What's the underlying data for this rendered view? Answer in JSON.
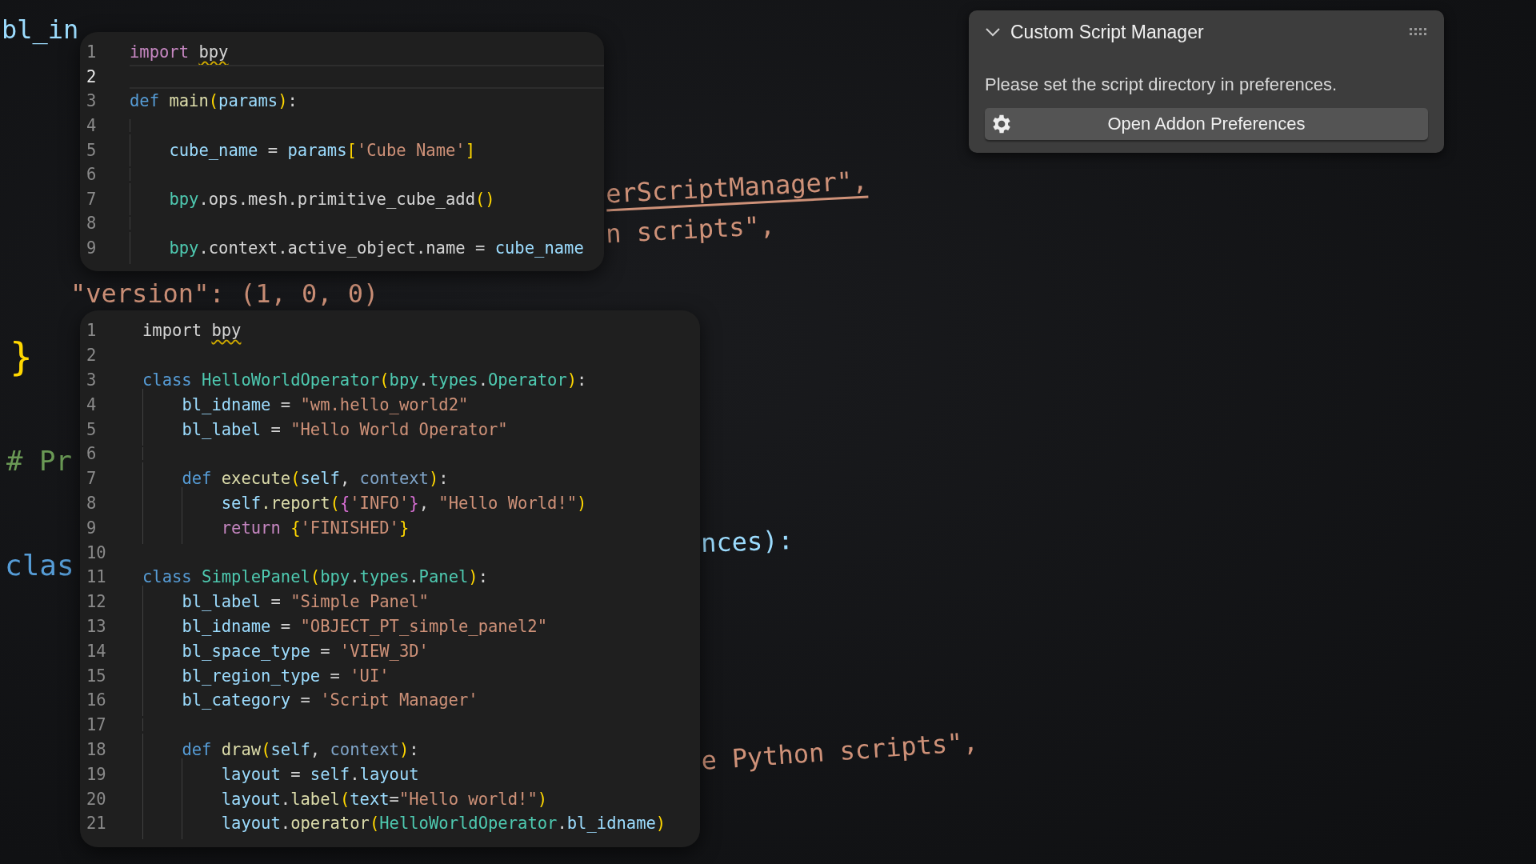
{
  "background_fragments": [
    {
      "text": "bl_in",
      "kind": "var"
    },
    {
      "text": "\"version\": (1, 0, 0)",
      "kind": "str"
    },
    {
      "text": "}",
      "kind": "br"
    },
    {
      "text": "# Pr",
      "kind": "comment"
    },
    {
      "text": "clas",
      "kind": "kw"
    },
    {
      "text": "erScriptManager\",",
      "kind": "link"
    },
    {
      "text": "n scripts\",",
      "kind": "str"
    },
    {
      "text": "nces):",
      "kind": "var"
    },
    {
      "text": "e Python scripts\",",
      "kind": "str"
    }
  ],
  "editors": [
    {
      "lines": [
        {
          "n": "1",
          "current": false,
          "tokens": [
            {
              "text": "import ",
              "kind": "imp"
            },
            {
              "text": "bpy",
              "kind": "warn"
            }
          ]
        },
        {
          "n": "2",
          "current": true
        },
        {
          "n": "3",
          "current": false,
          "tokens": [
            {
              "text": "def ",
              "kind": "kw"
            },
            {
              "text": "main",
              "kind": "fn"
            },
            {
              "text": "(",
              "kind": "br"
            },
            {
              "text": "params",
              "kind": "var"
            },
            {
              "text": ")",
              "kind": "br"
            },
            {
              "text": ":",
              "kind": "pl"
            }
          ]
        },
        {
          "n": "4",
          "current": false
        },
        {
          "n": "5",
          "current": false,
          "tokens": [
            {
              "text": "    cube_name",
              "kind": "var"
            },
            {
              "text": " = ",
              "kind": "pl"
            },
            {
              "text": "params",
              "kind": "var"
            },
            {
              "text": "[",
              "kind": "br"
            },
            {
              "text": "'Cube Name'",
              "kind": "str"
            },
            {
              "text": "]",
              "kind": "br"
            }
          ]
        },
        {
          "n": "6",
          "current": false
        },
        {
          "n": "7",
          "current": false,
          "tokens": [
            {
              "text": "    bpy",
              "kind": "cls"
            },
            {
              "text": ".ops.mesh.primitive_cube_add",
              "kind": "pl"
            },
            {
              "text": "()",
              "kind": "br"
            }
          ]
        },
        {
          "n": "8",
          "current": false
        },
        {
          "n": "9",
          "current": false,
          "tokens": [
            {
              "text": "    bpy",
              "kind": "cls"
            },
            {
              "text": ".context.active_object.name = ",
              "kind": "pl"
            },
            {
              "text": "cube_name",
              "kind": "var"
            }
          ]
        }
      ]
    },
    {
      "lines": [
        {
          "n": "1",
          "tokens": [
            {
              "text": "import ",
              "kind": "plain"
            },
            {
              "text": "bpy",
              "kind": "warn"
            }
          ]
        },
        {
          "n": "2"
        },
        {
          "n": "3",
          "tokens": [
            {
              "text": "class ",
              "kind": "kw"
            },
            {
              "text": "HelloWorldOperator",
              "kind": "cls"
            },
            {
              "text": "(",
              "kind": "br"
            },
            {
              "text": "bpy",
              "kind": "cls"
            },
            {
              "text": ".",
              "kind": "pl"
            },
            {
              "text": "types",
              "kind": "cls"
            },
            {
              "text": ".",
              "kind": "pl"
            },
            {
              "text": "Operator",
              "kind": "cls"
            },
            {
              "text": ")",
              "kind": "br"
            },
            {
              "text": ":",
              "kind": "pl"
            }
          ]
        },
        {
          "n": "4",
          "tokens": [
            {
              "text": "    bl_idname",
              "kind": "var"
            },
            {
              "text": " = ",
              "kind": "pl"
            },
            {
              "text": "\"wm.hello_world2\"",
              "kind": "str"
            }
          ]
        },
        {
          "n": "5",
          "tokens": [
            {
              "text": "    bl_label",
              "kind": "var"
            },
            {
              "text": " = ",
              "kind": "pl"
            },
            {
              "text": "\"Hello World Operator\"",
              "kind": "str"
            }
          ]
        },
        {
          "n": "6"
        },
        {
          "n": "7",
          "tokens": [
            {
              "text": "    def ",
              "kind": "kw"
            },
            {
              "text": "execute",
              "kind": "fn"
            },
            {
              "text": "(",
              "kind": "br"
            },
            {
              "text": "self",
              "kind": "var"
            },
            {
              "text": ", ",
              "kind": "pl"
            },
            {
              "text": "context",
              "kind": "dim"
            },
            {
              "text": ")",
              "kind": "br"
            },
            {
              "text": ":",
              "kind": "pl"
            }
          ]
        },
        {
          "n": "8",
          "tokens": [
            {
              "text": "        self",
              "kind": "var"
            },
            {
              "text": ".report",
              "kind": "fn"
            },
            {
              "text": "(",
              "kind": "br"
            },
            {
              "text": "{",
              "kind": "br2"
            },
            {
              "text": "'INFO'",
              "kind": "str"
            },
            {
              "text": "}",
              "kind": "br2"
            },
            {
              "text": ", ",
              "kind": "pl"
            },
            {
              "text": "\"Hello World!\"",
              "kind": "str"
            },
            {
              "text": ")",
              "kind": "br"
            }
          ]
        },
        {
          "n": "9",
          "tokens": [
            {
              "text": "        return ",
              "kind": "imp"
            },
            {
              "text": "{",
              "kind": "br"
            },
            {
              "text": "'FINISHED'",
              "kind": "str"
            },
            {
              "text": "}",
              "kind": "br"
            }
          ]
        },
        {
          "n": "10"
        },
        {
          "n": "11",
          "tokens": [
            {
              "text": "class ",
              "kind": "kw"
            },
            {
              "text": "SimplePanel",
              "kind": "cls"
            },
            {
              "text": "(",
              "kind": "br"
            },
            {
              "text": "bpy",
              "kind": "cls"
            },
            {
              "text": ".",
              "kind": "pl"
            },
            {
              "text": "types",
              "kind": "cls"
            },
            {
              "text": ".",
              "kind": "pl"
            },
            {
              "text": "Panel",
              "kind": "cls"
            },
            {
              "text": ")",
              "kind": "br"
            },
            {
              "text": ":",
              "kind": "pl"
            }
          ]
        },
        {
          "n": "12",
          "tokens": [
            {
              "text": "    bl_label",
              "kind": "var"
            },
            {
              "text": " = ",
              "kind": "pl"
            },
            {
              "text": "\"Simple Panel\"",
              "kind": "str"
            }
          ]
        },
        {
          "n": "13",
          "tokens": [
            {
              "text": "    bl_idname",
              "kind": "var"
            },
            {
              "text": " = ",
              "kind": "pl"
            },
            {
              "text": "\"OBJECT_PT_simple_panel2\"",
              "kind": "str"
            }
          ]
        },
        {
          "n": "14",
          "tokens": [
            {
              "text": "    bl_space_type",
              "kind": "var"
            },
            {
              "text": " = ",
              "kind": "pl"
            },
            {
              "text": "'VIEW_3D'",
              "kind": "str"
            }
          ]
        },
        {
          "n": "15",
          "tokens": [
            {
              "text": "    bl_region_type",
              "kind": "var"
            },
            {
              "text": " = ",
              "kind": "pl"
            },
            {
              "text": "'UI'",
              "kind": "str"
            }
          ]
        },
        {
          "n": "16",
          "tokens": [
            {
              "text": "    bl_category",
              "kind": "var"
            },
            {
              "text": " = ",
              "kind": "pl"
            },
            {
              "text": "'Script Manager'",
              "kind": "str"
            }
          ]
        },
        {
          "n": "17"
        },
        {
          "n": "18",
          "tokens": [
            {
              "text": "    def ",
              "kind": "kw"
            },
            {
              "text": "draw",
              "kind": "fn"
            },
            {
              "text": "(",
              "kind": "br"
            },
            {
              "text": "self",
              "kind": "var"
            },
            {
              "text": ", ",
              "kind": "pl"
            },
            {
              "text": "context",
              "kind": "dim"
            },
            {
              "text": ")",
              "kind": "br"
            },
            {
              "text": ":",
              "kind": "pl"
            }
          ]
        },
        {
          "n": "19",
          "tokens": [
            {
              "text": "        layout",
              "kind": "var"
            },
            {
              "text": " = ",
              "kind": "pl"
            },
            {
              "text": "self",
              "kind": "var"
            },
            {
              "text": ".",
              "kind": "pl"
            },
            {
              "text": "layout",
              "kind": "var"
            }
          ]
        },
        {
          "n": "20",
          "tokens": [
            {
              "text": "        layout",
              "kind": "var"
            },
            {
              "text": ".",
              "kind": "pl"
            },
            {
              "text": "label",
              "kind": "fn"
            },
            {
              "text": "(",
              "kind": "br"
            },
            {
              "text": "text",
              "kind": "var"
            },
            {
              "text": "=",
              "kind": "pl"
            },
            {
              "text": "\"Hello world!\"",
              "kind": "str"
            },
            {
              "text": ")",
              "kind": "br"
            }
          ]
        },
        {
          "n": "21",
          "tokens": [
            {
              "text": "        layout",
              "kind": "var"
            },
            {
              "text": ".",
              "kind": "pl"
            },
            {
              "text": "operator",
              "kind": "fn"
            },
            {
              "text": "(",
              "kind": "br"
            },
            {
              "text": "HelloWorldOperator",
              "kind": "cls"
            },
            {
              "text": ".",
              "kind": "pl"
            },
            {
              "text": "bl_idname",
              "kind": "var"
            },
            {
              "text": ")",
              "kind": "br"
            }
          ]
        }
      ]
    }
  ],
  "panel": {
    "title": "Custom Script Manager",
    "expanded": true,
    "message": "Please set the script directory in preferences.",
    "button": "Open Addon Preferences"
  }
}
